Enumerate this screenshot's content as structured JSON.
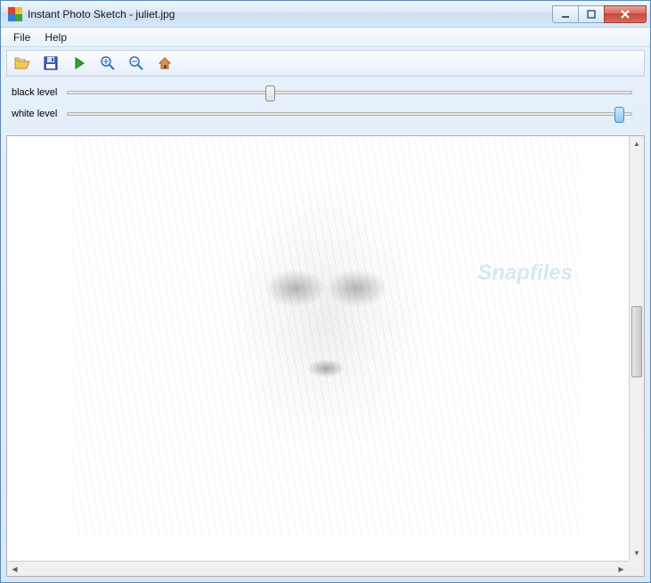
{
  "window": {
    "title": "Instant Photo Sketch - juliet.jpg"
  },
  "menu": {
    "file": "File",
    "help": "Help"
  },
  "toolbar": {
    "open": "open-icon",
    "save": "save-icon",
    "play": "play-icon",
    "zoom_in": "zoom-in-icon",
    "zoom_out": "zoom-out-icon",
    "home": "home-icon"
  },
  "sliders": {
    "black": {
      "label": "black level",
      "value": 35,
      "min": 0,
      "max": 100
    },
    "white": {
      "label": "white level",
      "value": 97,
      "min": 0,
      "max": 100
    }
  },
  "watermark": "Snapfiles",
  "colors": {
    "accent": "#4a90c0",
    "close_btn": "#c74a3a",
    "chrome_gradient_top": "#e8f1fb",
    "chrome_gradient_bottom": "#d9e8f7"
  }
}
